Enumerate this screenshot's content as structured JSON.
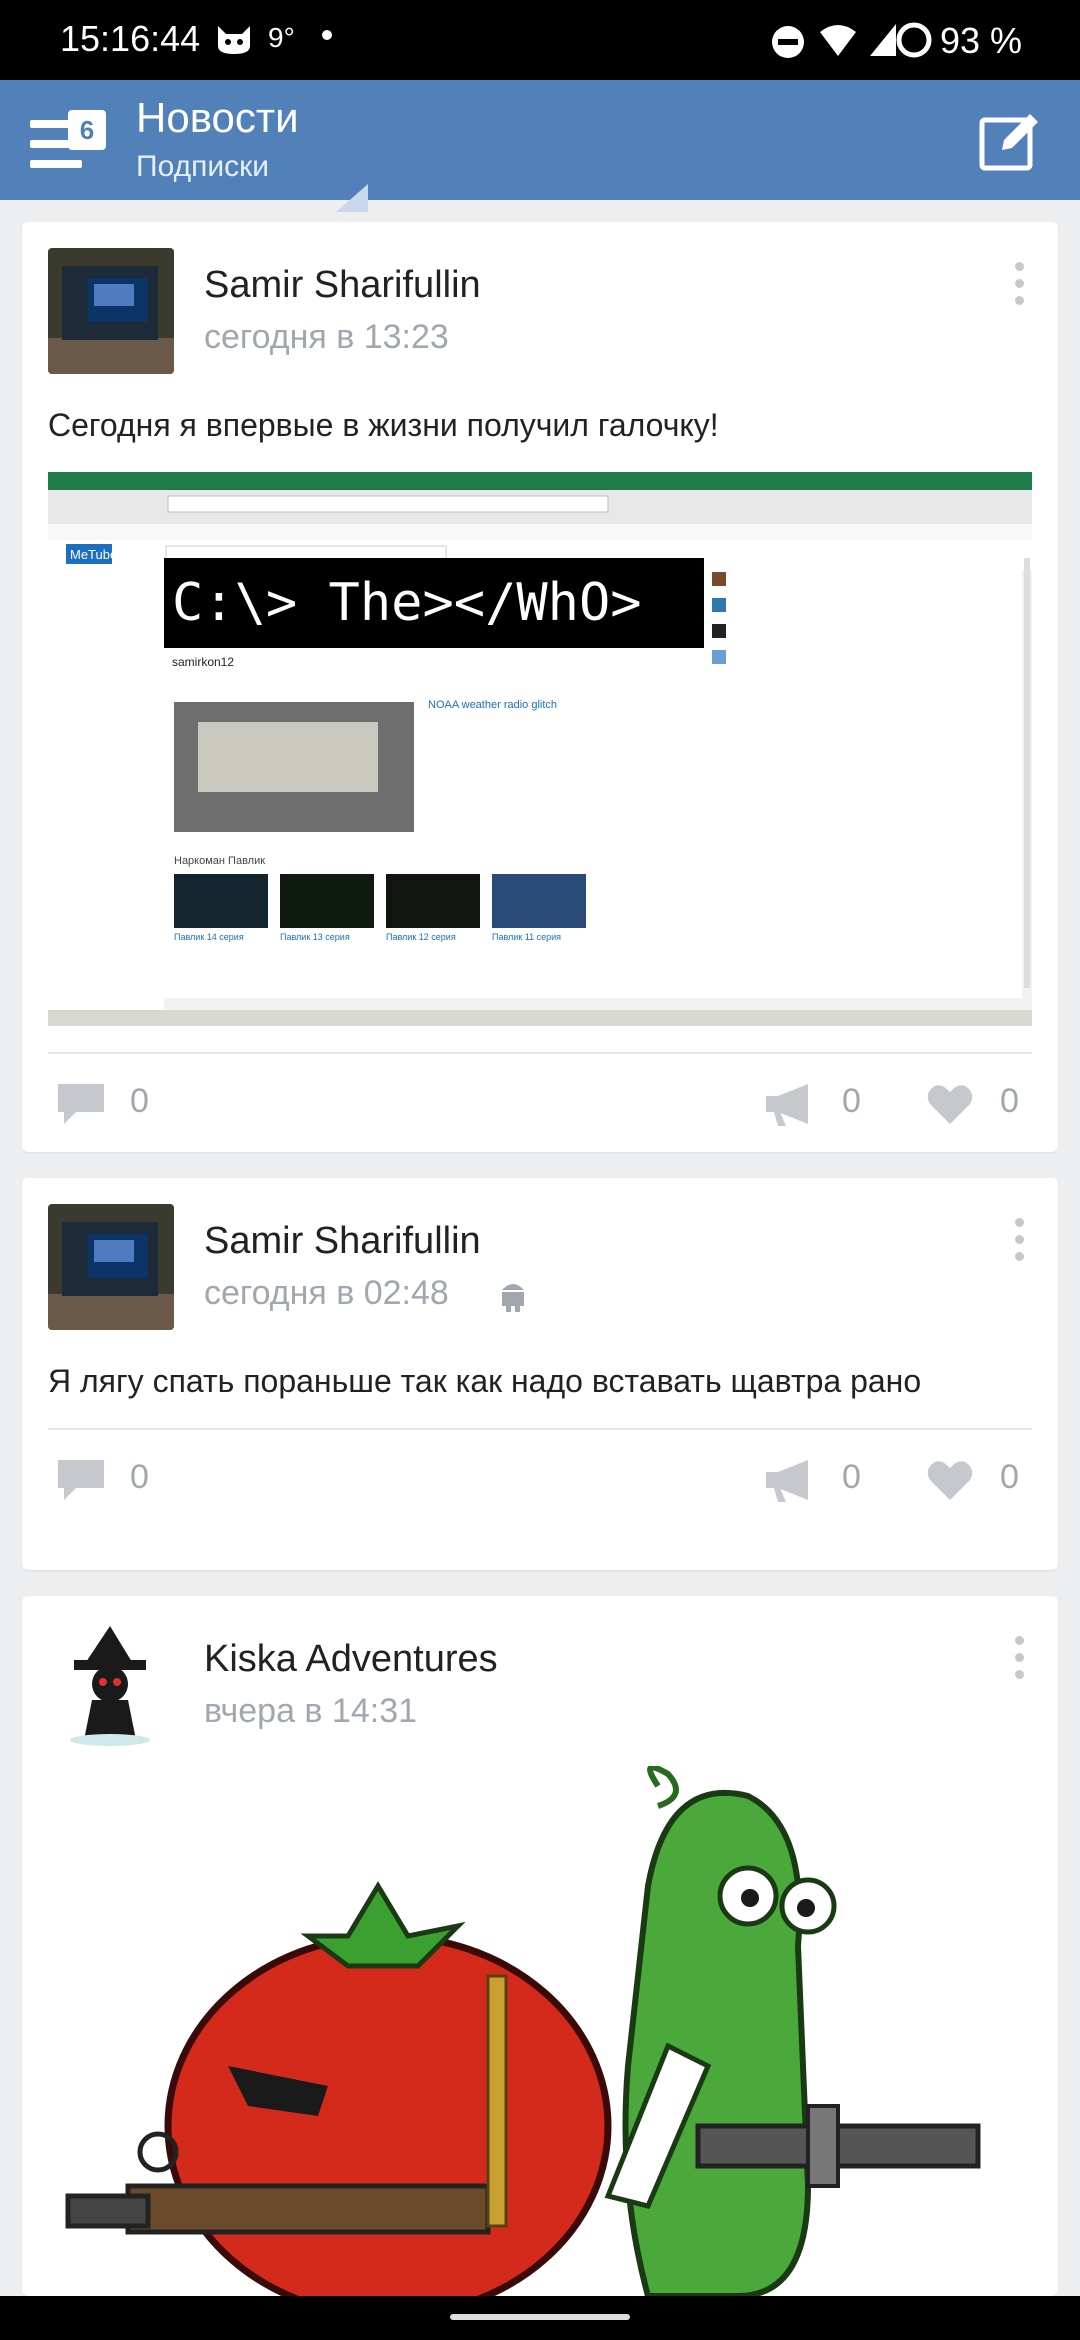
{
  "status_bar": {
    "time": "15:16:44",
    "temperature": "9°",
    "battery": "93 %"
  },
  "header": {
    "title": "Новости",
    "subtitle": "Подписки",
    "menu_badge": "6",
    "icons": [
      "menu-icon",
      "edit-icon"
    ]
  },
  "posts": [
    {
      "author": "Samir Sharifullin",
      "time": "сегодня в 13:23",
      "text": "Сегодня я впервые в жизни получил галочку!",
      "comments": "0",
      "reposts": "0",
      "likes": "0",
      "screenshot": {
        "site_name": "MeTube",
        "banner": "C:\\> The></WhO>",
        "channel": "samirkon12",
        "video_title": "NOAA weather radio glitch",
        "section": "Наркоман Павлик",
        "videos": [
          "Павлик 14 серия",
          "Павлик 13 серия",
          "Павлик 12 серия",
          "Павлик 11 серия"
        ]
      }
    },
    {
      "author": "Samir Sharifullin",
      "time": "сегодня в 02:48",
      "text": "Я лягу спать пораньше так как надо вставать щавтра рано",
      "comments": "0",
      "reposts": "0",
      "likes": "0"
    },
    {
      "author": "Kiska Adventures",
      "time": "вчера в 14:31"
    }
  ],
  "colors": {
    "accent": "#5181b8",
    "background": "#edeef0",
    "muted": "#a1a7ae"
  }
}
